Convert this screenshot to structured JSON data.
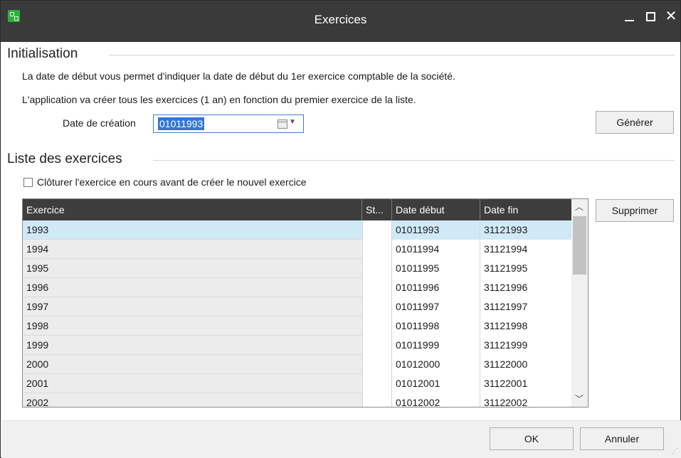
{
  "window": {
    "title": "Exercices",
    "icon": "app-grid-icon",
    "controls": {
      "minimize": "minimize-icon",
      "maximize": "maximize-icon",
      "close": "close-icon"
    }
  },
  "init": {
    "heading": "Initialisation",
    "desc1": "La date de début vous permet d'indiquer la date de début du 1er exercice comptable de la société.",
    "desc2": "L'application va créer tous les exercices (1 an) en fonction du premier exercice de la liste.",
    "date_label": "Date de création",
    "date_value": "01011993",
    "generate_label": "Générer"
  },
  "list": {
    "heading": "Liste des exercices",
    "close_checkbox_label": "Clôturer l'exercice en cours avant de créer le nouvel exercice",
    "close_checkbox_checked": false,
    "delete_label": "Supprimer",
    "columns": [
      "Exercice",
      "St...",
      "Date début",
      "Date fin"
    ],
    "rows": [
      {
        "exercice": "1993",
        "statut": "",
        "debut": "01011993",
        "fin": "31121993",
        "selected": true
      },
      {
        "exercice": "1994",
        "statut": "",
        "debut": "01011994",
        "fin": "31121994"
      },
      {
        "exercice": "1995",
        "statut": "",
        "debut": "01011995",
        "fin": "31121995"
      },
      {
        "exercice": "1996",
        "statut": "",
        "debut": "01011996",
        "fin": "31121996"
      },
      {
        "exercice": "1997",
        "statut": "",
        "debut": "01011997",
        "fin": "31121997"
      },
      {
        "exercice": "1998",
        "statut": "",
        "debut": "01011998",
        "fin": "31121998"
      },
      {
        "exercice": "1999",
        "statut": "",
        "debut": "01011999",
        "fin": "31121999"
      },
      {
        "exercice": "2000",
        "statut": "",
        "debut": "01012000",
        "fin": "31122000"
      },
      {
        "exercice": "2001",
        "statut": "",
        "debut": "01012001",
        "fin": "31122001"
      },
      {
        "exercice": "2002",
        "statut": "",
        "debut": "01012002",
        "fin": "31122002"
      }
    ]
  },
  "footer": {
    "ok_label": "OK",
    "cancel_label": "Annuler"
  },
  "colors": {
    "titlebar": "#3a3a3a",
    "grid_header": "#3d3d3d",
    "selection": "#cfe9f7",
    "accent": "#3277d6",
    "app_icon": "#2fae3a"
  }
}
